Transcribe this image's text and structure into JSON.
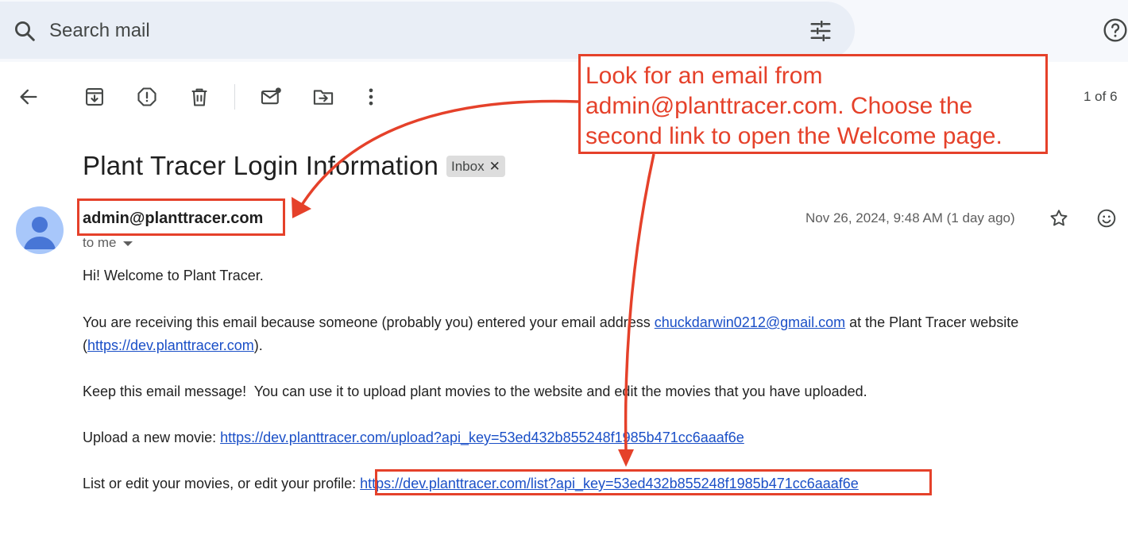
{
  "search": {
    "placeholder": "Search mail"
  },
  "toolbar": {
    "back_icon": "arrow-left-icon",
    "archive_icon": "archive-icon",
    "spam_icon": "report-spam-icon",
    "delete_icon": "trash-icon",
    "unread_icon": "mark-unread-icon",
    "move_icon": "move-to-icon",
    "more_icon": "more-vert-icon",
    "count": "1 of 6"
  },
  "email": {
    "subject": "Plant Tracer Login Information",
    "label": "Inbox",
    "sender": "admin@planttracer.com",
    "to": "to me",
    "date": "Nov 26, 2024, 9:48 AM (1 day ago)",
    "greeting": "Hi! Welcome to Plant Tracer.",
    "para1_a": "You are receiving this email because someone (probably you) entered your email address ",
    "para1_link": "chuckdarwin0212@gmail.com",
    "para1_b": " at the Plant Tracer website",
    "para1_c": "(",
    "para1_site": "https://dev.planttracer.com",
    "para1_d": ").",
    "para2": "Keep this email message!  You can use it to upload plant movies to the website and edit the movies that you have uploaded.",
    "upload_label": "Upload a new movie: ",
    "upload_link": "https://dev.planttracer.com/upload?api_key=53ed432b855248f1985b471cc6aaaf6e",
    "list_label": "List or edit your movies, or edit your profile: ",
    "list_link": "https://dev.planttracer.com/list?api_key=53ed432b855248f1985b471cc6aaaf6e"
  },
  "annotation": {
    "lines": [
      "Look for an email from",
      "admin@planttracer.com. Choose the",
      "second link to open the Welcome page."
    ],
    "color": "#e5412a"
  },
  "colors": {
    "link": "#1a4fc7",
    "search_bg": "#e9eef6",
    "app_bg": "#f6f8fc"
  }
}
